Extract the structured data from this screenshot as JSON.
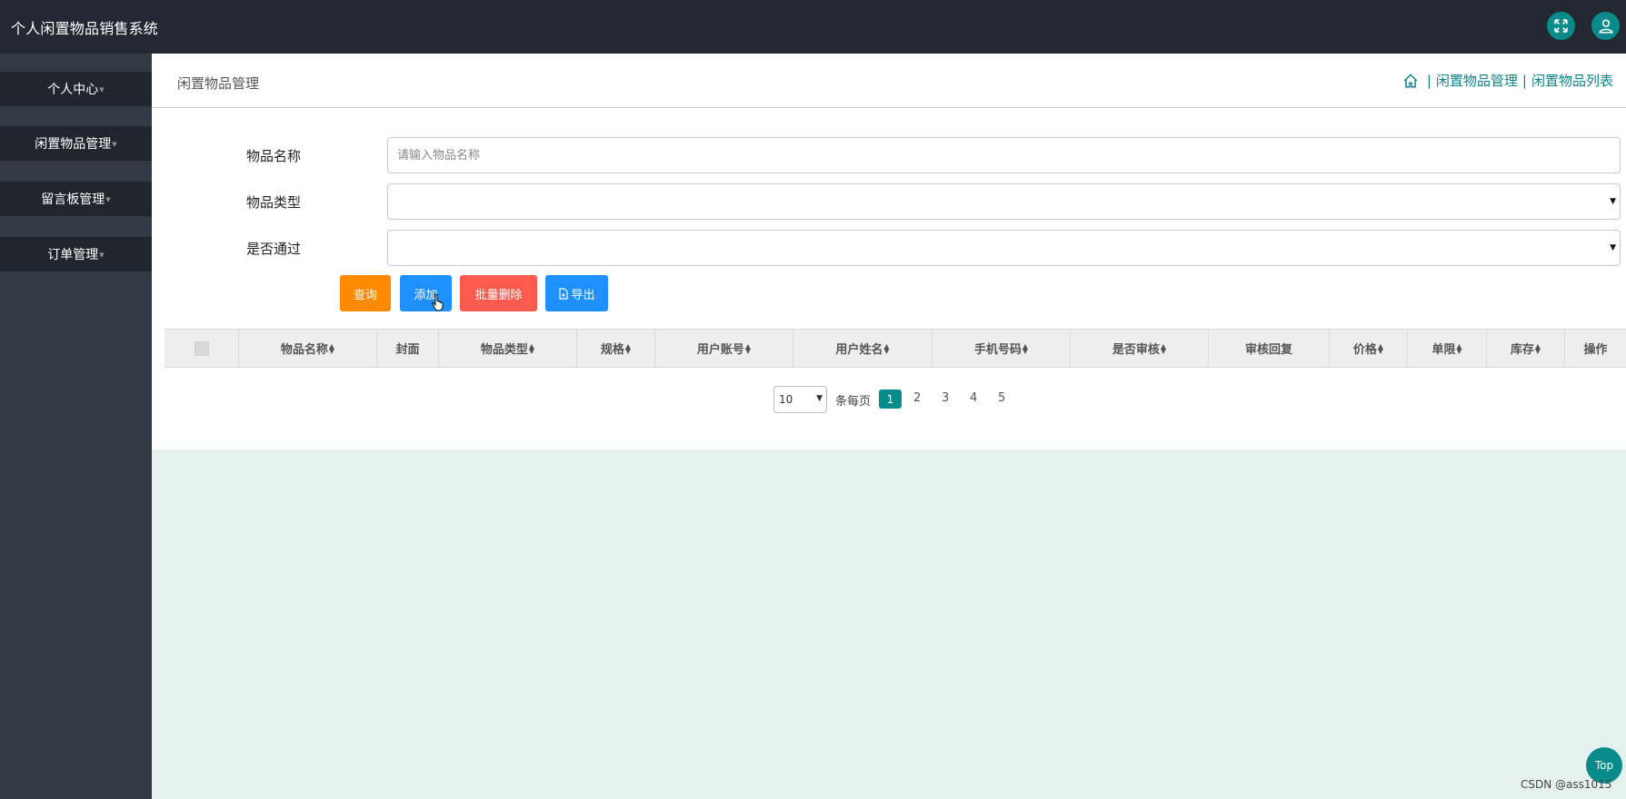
{
  "app": {
    "title": "个人闲置物品销售系统"
  },
  "header_icons": [
    "fullscreen-icon",
    "user-icon"
  ],
  "sidebar": {
    "items": [
      {
        "label": "个人中心"
      },
      {
        "label": "闲置物品管理"
      },
      {
        "label": "留言板管理"
      },
      {
        "label": "订单管理"
      }
    ]
  },
  "page": {
    "title": "闲置物品管理",
    "breadcrumb": [
      "闲置物品管理",
      "闲置物品列表"
    ],
    "breadcrumb_sep": "|"
  },
  "form": {
    "name_label": "物品名称",
    "name_placeholder": "请输入物品名称",
    "name_value": "",
    "type_label": "物品类型",
    "type_value": "",
    "approved_label": "是否通过",
    "approved_value": ""
  },
  "buttons": {
    "query": "查询",
    "add": "添加",
    "batch_delete": "批量删除",
    "export": "导出"
  },
  "table": {
    "columns": [
      "物品名称",
      "封面",
      "物品类型",
      "规格",
      "用户账号",
      "用户姓名",
      "手机号码",
      "是否审核",
      "审核回复",
      "价格",
      "单限",
      "库存",
      "操作"
    ]
  },
  "pagination": {
    "page_size": "10",
    "per_page_label": "条每页",
    "current": "1",
    "pages": [
      "2",
      "3",
      "4",
      "5"
    ]
  },
  "back_to_top": "Top",
  "watermark": "CSDN @ass1015",
  "colors": {
    "accent": "#0a8b8b",
    "query": "#ff8a00",
    "primary": "#1e90ff",
    "danger": "#ff5a4e"
  }
}
